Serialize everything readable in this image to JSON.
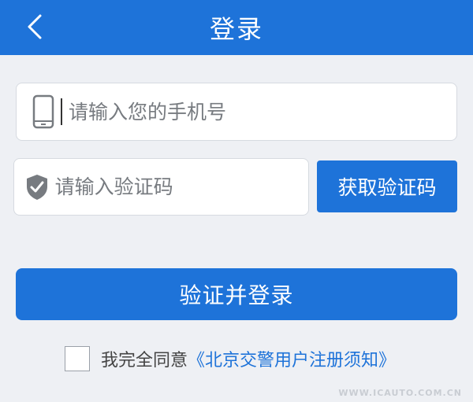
{
  "header": {
    "title": "登录",
    "back_icon": "chevron-left-icon"
  },
  "form": {
    "phone": {
      "placeholder": "请输入您的手机号",
      "value": "",
      "icon": "smartphone-icon"
    },
    "code": {
      "placeholder": "请输入验证码",
      "value": "",
      "icon": "shield-check-icon"
    },
    "get_code_label": "获取验证码",
    "submit_label": "验证并登录"
  },
  "agreement": {
    "text": "我完全同意",
    "link": "《北京交警用户注册须知》",
    "checked": false
  },
  "watermark": "WWW.ICAUTO.COM.CN",
  "colors": {
    "primary": "#1e73d9",
    "background": "#eef0f4",
    "placeholder": "#777b80"
  }
}
